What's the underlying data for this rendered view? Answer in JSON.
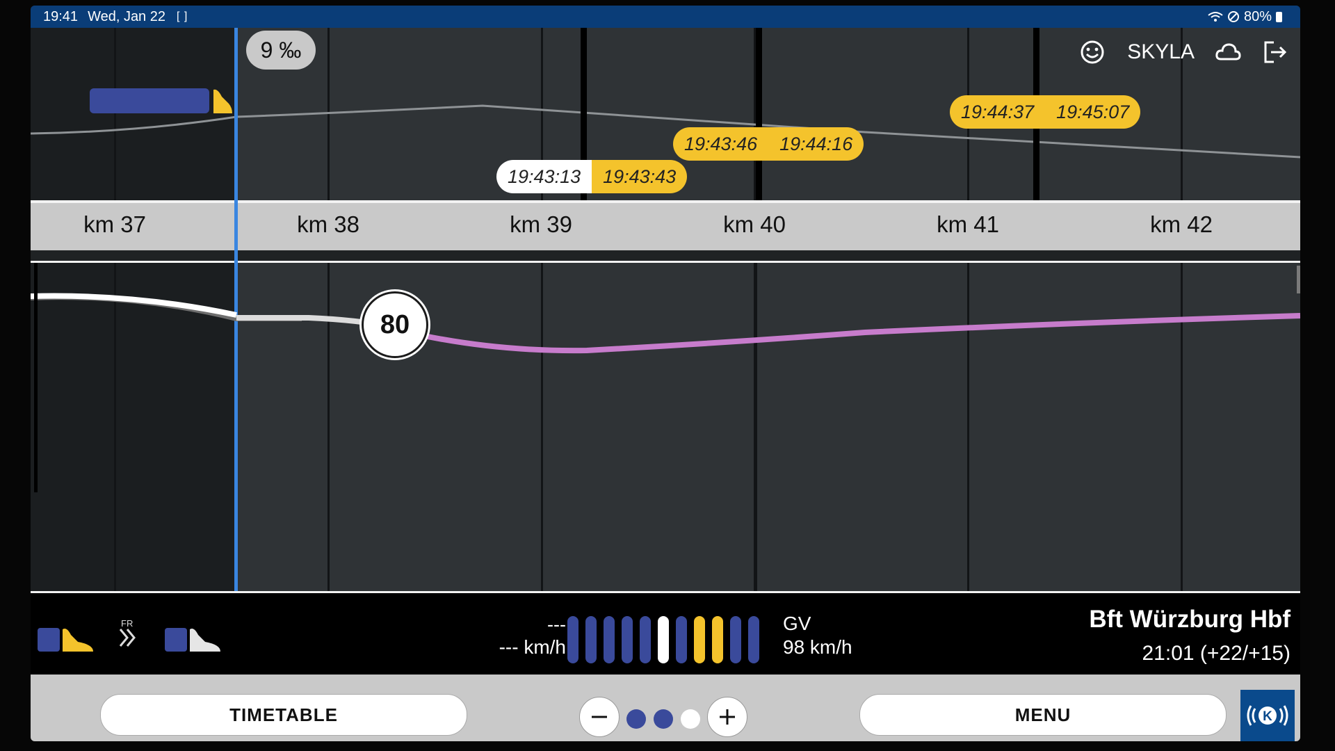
{
  "status_bar": {
    "time": "19:41",
    "date": "Wed, Jan 22",
    "fullscreen_glyph": "[ ]",
    "battery": "80%",
    "icons": [
      "wifi-icon",
      "do-not-disturb-icon",
      "battery-icon"
    ]
  },
  "header": {
    "gradient": "9 ‰",
    "user_label": "SKYLA",
    "icons": [
      "smiley-icon",
      "cloud-icon",
      "logout-icon"
    ]
  },
  "timing_points": [
    {
      "scheduled": "19:43:13",
      "actual": "19:43:43",
      "scheduled_color": "#ffffff"
    },
    {
      "scheduled": "19:43:46",
      "actual": "19:44:16",
      "scheduled_color": "#f4c32c"
    },
    {
      "scheduled": "19:44:37",
      "actual": "19:45:07",
      "scheduled_color": "#f4c32c"
    }
  ],
  "ruler": {
    "labels": [
      "km 37",
      "km 38",
      "km 39",
      "km 40",
      "km 41",
      "km 42"
    ]
  },
  "speed_sign": {
    "value": "80"
  },
  "info_bar": {
    "fr_label": "FR",
    "speed_dash": "---",
    "speed_value": "--- km/h",
    "indicator_bars": [
      "#3a4a9b",
      "#3a4a9b",
      "#3a4a9b",
      "#3a4a9b",
      "#3a4a9b",
      "#ffffff",
      "#3a4a9b",
      "#f4c32c",
      "#f4c32c",
      "#3a4a9b",
      "#3a4a9b"
    ],
    "gv_label": "GV",
    "gv_speed": "98 km/h",
    "station": "Bft Würzburg Hbf",
    "eta": "21:01 (+22/+15)"
  },
  "bottom_bar": {
    "timetable_label": "TIMETABLE",
    "menu_label": "MENU",
    "zoom_dots": [
      "#3a4a9b",
      "#3a4a9b",
      "#ffffff"
    ],
    "icons": [
      "zoom-out-icon",
      "zoom-in-icon",
      "brand-logo-icon"
    ]
  },
  "colors": {
    "status_bar": "#0a3d78",
    "position_line": "#3a86e0",
    "speed_profile": "#c77ccc",
    "highlight_yellow": "#f4c32c",
    "train_blue": "#3a4a9b"
  }
}
